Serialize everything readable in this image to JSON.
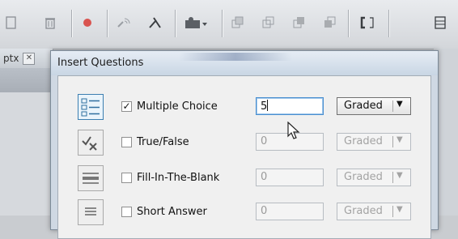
{
  "toolbar": {
    "icons": [
      "page-icon",
      "trash-icon",
      "record-icon",
      "audio-icon",
      "no-audio-icon",
      "slide-icon",
      "copy-icon",
      "duplicate-icon",
      "paste-icon",
      "layer-icon",
      "bracket-icon",
      "grid-icon"
    ]
  },
  "doc_tab": {
    "label": "ptx",
    "close": "✕"
  },
  "dialog": {
    "title": "Insert Questions",
    "questions": [
      {
        "label": "Multiple Choice",
        "checked": true,
        "count": "5",
        "grading": "Graded",
        "icon": "multiple-choice-icon"
      },
      {
        "label": "True/False",
        "checked": false,
        "count": "0",
        "grading": "Graded",
        "icon": "true-false-icon"
      },
      {
        "label": "Fill-In-The-Blank",
        "checked": false,
        "count": "0",
        "grading": "Graded",
        "icon": "fill-in-blank-icon"
      },
      {
        "label": "Short Answer",
        "checked": false,
        "count": "0",
        "grading": "Graded",
        "icon": "short-answer-icon"
      }
    ],
    "checked_mark": "✓",
    "dropdown_arrow": "▼"
  },
  "colors": {
    "accent": "#3c7fb1",
    "record": "#d9534f"
  }
}
